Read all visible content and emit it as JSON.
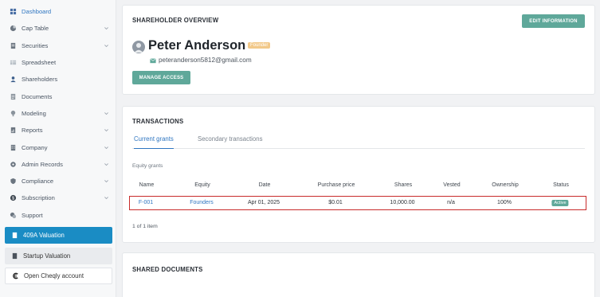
{
  "sidebar": {
    "items": [
      {
        "label": "Dashboard",
        "icon": "dashboard-icon",
        "chevron": false
      },
      {
        "label": "Cap Table",
        "icon": "cap-table-icon",
        "chevron": true
      },
      {
        "label": "Securities",
        "icon": "securities-icon",
        "chevron": true
      },
      {
        "label": "Spreadsheet",
        "icon": "spreadsheet-icon",
        "chevron": false
      },
      {
        "label": "Shareholders",
        "icon": "shareholders-icon",
        "chevron": false
      },
      {
        "label": "Documents",
        "icon": "documents-icon",
        "chevron": false
      },
      {
        "label": "Modeling",
        "icon": "modeling-icon",
        "chevron": true
      },
      {
        "label": "Reports",
        "icon": "reports-icon",
        "chevron": true
      },
      {
        "label": "Company",
        "icon": "company-icon",
        "chevron": true
      },
      {
        "label": "Admin Records",
        "icon": "admin-records-icon",
        "chevron": true
      },
      {
        "label": "Compliance",
        "icon": "compliance-icon",
        "chevron": true
      },
      {
        "label": "Subscription",
        "icon": "subscription-icon",
        "chevron": true
      },
      {
        "label": "Support",
        "icon": "support-icon",
        "chevron": false
      }
    ],
    "btn_409a": "409A Valuation",
    "btn_startup": "Startup Valuation",
    "btn_open": "Open Cheqly account"
  },
  "overview": {
    "title": "SHAREHOLDER OVERVIEW",
    "edit_label": "EDIT INFORMATION",
    "name": "Peter Anderson",
    "role_badge": "Founder",
    "email": "peteranderson5812@gmail.com",
    "manage_label": "MANAGE ACCESS"
  },
  "transactions": {
    "title": "TRANSACTIONS",
    "tabs": [
      "Current grants",
      "Secondary transactions"
    ],
    "section_label": "Equity grants",
    "columns": [
      "Name",
      "Equity",
      "Date",
      "Purchase price",
      "Shares",
      "Vested",
      "Ownership",
      "Status"
    ],
    "row": {
      "name": "F-001",
      "equity": "Founders",
      "date": "Apr 01, 2025",
      "price": "$0.01",
      "shares": "10,000.00",
      "vested": "n/a",
      "ownership": "100%",
      "status": "Active"
    },
    "pager": "1 of 1 item"
  },
  "docs": {
    "title": "SHARED DOCUMENTS"
  },
  "colors": {
    "accent": "#5fa89a",
    "link": "#2f76c1",
    "primary_button": "#1a8cc4",
    "highlight": "#c82b2b"
  }
}
